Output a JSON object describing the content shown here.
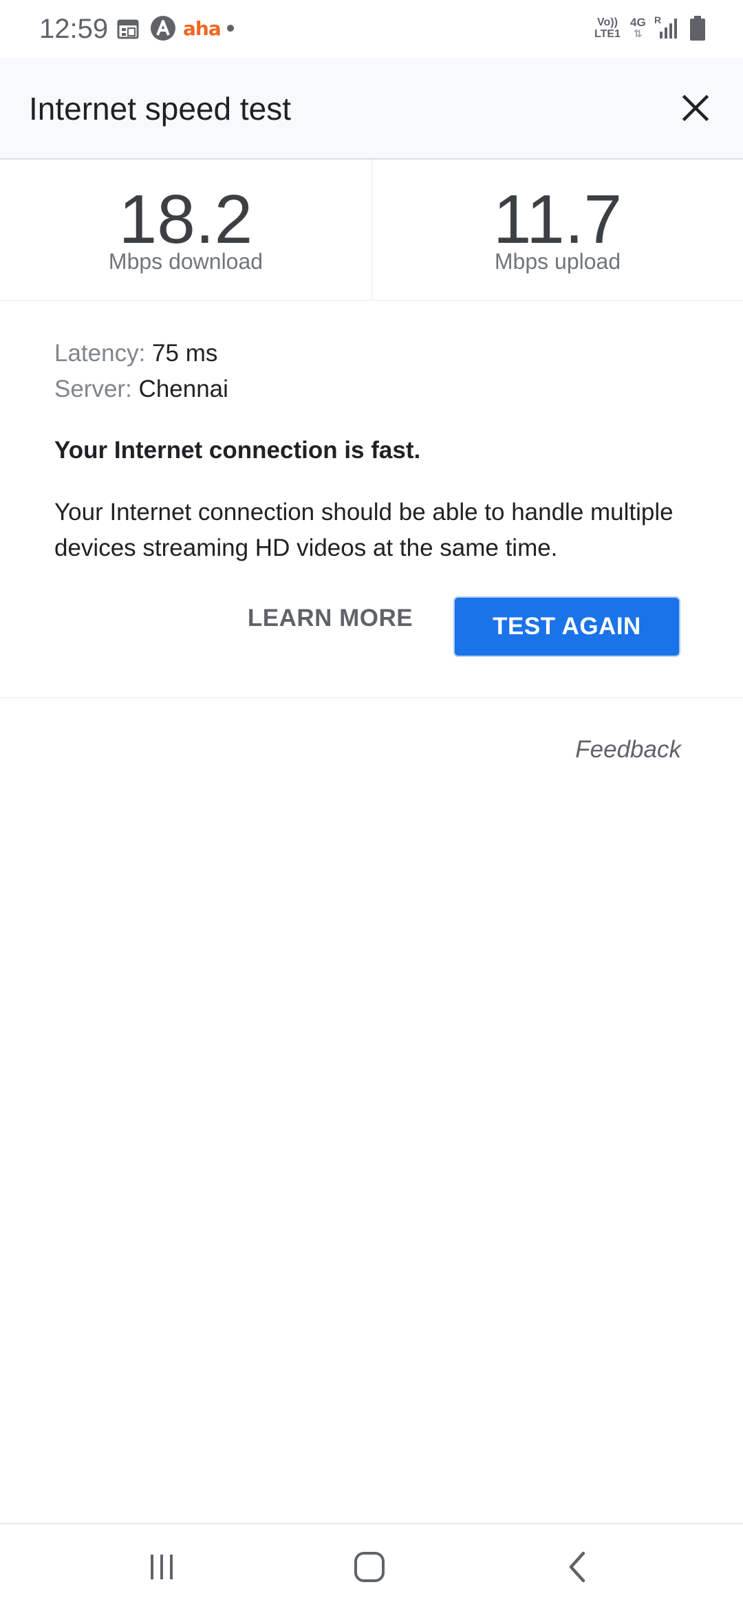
{
  "status_bar": {
    "time": "12:59",
    "aha_label": "aha",
    "volte_line1": "Vo))",
    "volte_line2": "LTE1",
    "network": "4G",
    "roaming": "R"
  },
  "header": {
    "title": "Internet speed test"
  },
  "speeds": {
    "download_value": "18.2",
    "download_label": "Mbps download",
    "upload_value": "11.7",
    "upload_label": "Mbps upload"
  },
  "details": {
    "latency_label": "Latency:",
    "latency_value": "75 ms",
    "server_label": "Server:",
    "server_value": "Chennai",
    "verdict": "Your Internet connection is fast.",
    "description": "Your Internet connection should be able to handle multiple devices streaming HD videos at the same time."
  },
  "actions": {
    "learn_more": "LEARN MORE",
    "test_again": "TEST AGAIN"
  },
  "footer": {
    "feedback": "Feedback"
  },
  "colors": {
    "accent": "#1a73e8",
    "header_bg": "#f8f9fa",
    "aha_brand": "#f26522"
  },
  "icons": {
    "close": "close-icon",
    "calendar": "calendar-icon",
    "a_app": "a-app-icon",
    "signal": "signal-icon",
    "battery": "battery-icon",
    "recent_apps": "recent-apps-icon",
    "home": "home-icon",
    "back": "back-icon"
  }
}
